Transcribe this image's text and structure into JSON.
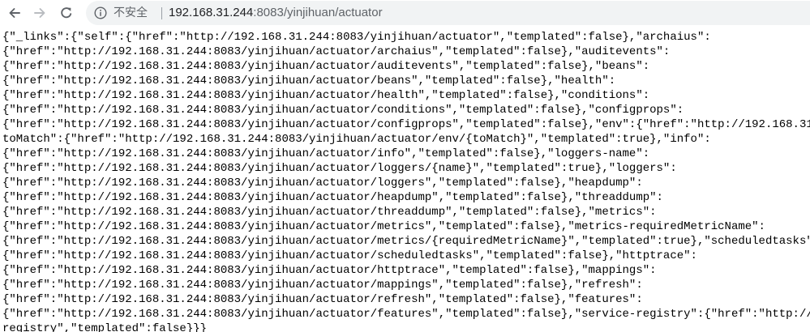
{
  "browser": {
    "security_label": "不安全",
    "url_host": "192.168.31.244",
    "url_rest": ":8083/yinjihuan/actuator"
  },
  "content": {
    "lines": [
      "{\"_links\":{\"self\":{\"href\":\"http://192.168.31.244:8083/yinjihuan/actuator\",\"templated\":false},\"archaius\":",
      "{\"href\":\"http://192.168.31.244:8083/yinjihuan/actuator/archaius\",\"templated\":false},\"auditevents\":",
      "{\"href\":\"http://192.168.31.244:8083/yinjihuan/actuator/auditevents\",\"templated\":false},\"beans\":",
      "{\"href\":\"http://192.168.31.244:8083/yinjihuan/actuator/beans\",\"templated\":false},\"health\":",
      "{\"href\":\"http://192.168.31.244:8083/yinjihuan/actuator/health\",\"templated\":false},\"conditions\":",
      "{\"href\":\"http://192.168.31.244:8083/yinjihuan/actuator/conditions\",\"templated\":false},\"configprops\":",
      "{\"href\":\"http://192.168.31.244:8083/yinjihuan/actuator/configprops\",\"templated\":false},\"env\":{\"href\":\"http://192.168.31.",
      "toMatch\":{\"href\":\"http://192.168.31.244:8083/yinjihuan/actuator/env/{toMatch}\",\"templated\":true},\"info\":",
      "{\"href\":\"http://192.168.31.244:8083/yinjihuan/actuator/info\",\"templated\":false},\"loggers-name\":",
      "{\"href\":\"http://192.168.31.244:8083/yinjihuan/actuator/loggers/{name}\",\"templated\":true},\"loggers\":",
      "{\"href\":\"http://192.168.31.244:8083/yinjihuan/actuator/loggers\",\"templated\":false},\"heapdump\":",
      "{\"href\":\"http://192.168.31.244:8083/yinjihuan/actuator/heapdump\",\"templated\":false},\"threaddump\":",
      "{\"href\":\"http://192.168.31.244:8083/yinjihuan/actuator/threaddump\",\"templated\":false},\"metrics\":",
      "{\"href\":\"http://192.168.31.244:8083/yinjihuan/actuator/metrics\",\"templated\":false},\"metrics-requiredMetricName\":",
      "{\"href\":\"http://192.168.31.244:8083/yinjihuan/actuator/metrics/{requiredMetricName}\",\"templated\":true},\"scheduledtasks\":",
      "{\"href\":\"http://192.168.31.244:8083/yinjihuan/actuator/scheduledtasks\",\"templated\":false},\"httptrace\":",
      "{\"href\":\"http://192.168.31.244:8083/yinjihuan/actuator/httptrace\",\"templated\":false},\"mappings\":",
      "{\"href\":\"http://192.168.31.244:8083/yinjihuan/actuator/mappings\",\"templated\":false},\"refresh\":",
      "{\"href\":\"http://192.168.31.244:8083/yinjihuan/actuator/refresh\",\"templated\":false},\"features\":",
      "{\"href\":\"http://192.168.31.244:8083/yinjihuan/actuator/features\",\"templated\":false},\"service-registry\":{\"href\":\"http://1",
      "registry\",\"templated\":false}}}"
    ]
  }
}
